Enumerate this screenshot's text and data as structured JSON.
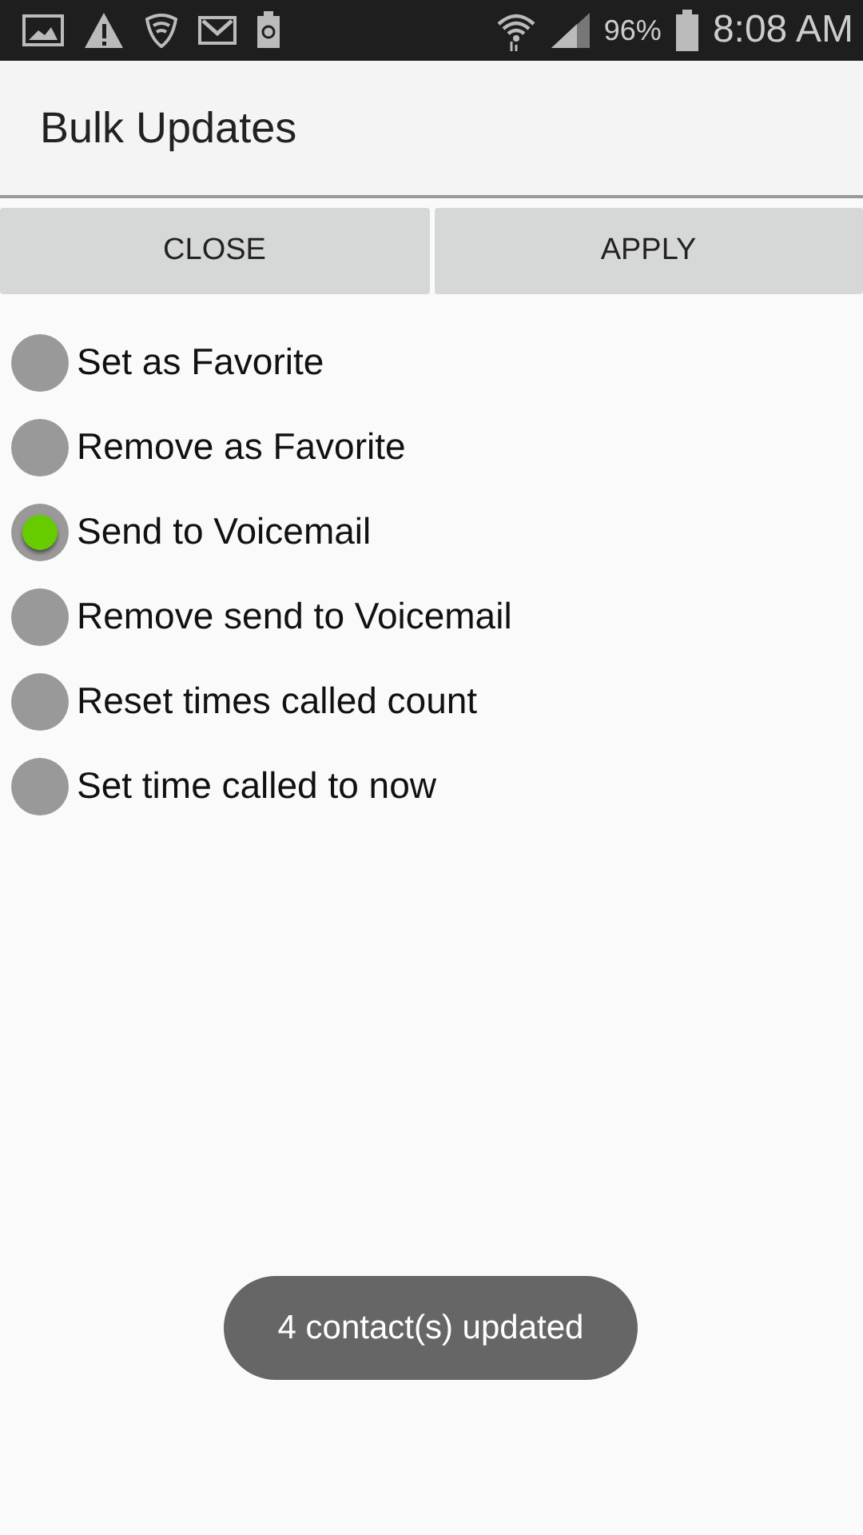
{
  "status_bar": {
    "battery": "96%",
    "time": "8:08 AM"
  },
  "title": "Bulk Updates",
  "buttons": [
    "CLOSE",
    "APPLY"
  ],
  "options": [
    {
      "label": "Set as Favorite",
      "selected": false
    },
    {
      "label": "Remove as Favorite",
      "selected": false
    },
    {
      "label": "Send to Voicemail",
      "selected": true
    },
    {
      "label": "Remove send to Voicemail",
      "selected": false
    },
    {
      "label": "Reset times called count",
      "selected": false
    },
    {
      "label": "Set time called to now",
      "selected": false
    }
  ],
  "toast": "4 contact(s) updated"
}
